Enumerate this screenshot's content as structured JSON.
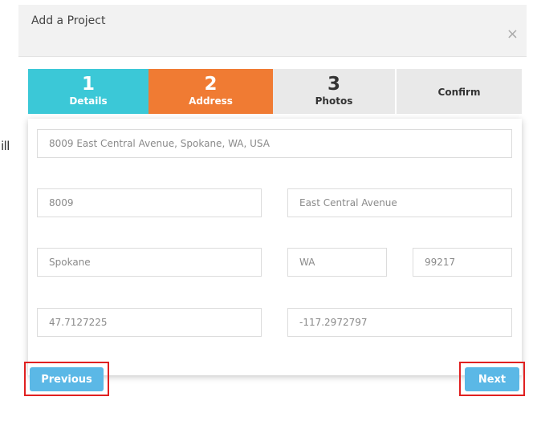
{
  "background": {
    "partial_text": "ill"
  },
  "modal": {
    "title": "Add a Project",
    "close_glyph": "×"
  },
  "steps": [
    {
      "number": "1",
      "label": "Details",
      "state": "complete",
      "color": "#3bc8d7"
    },
    {
      "number": "2",
      "label": "Address",
      "state": "active",
      "color": "#f07b33"
    },
    {
      "number": "3",
      "label": "Photos",
      "state": "pending",
      "color": "#e9e9e9"
    },
    {
      "number": "",
      "label": "Confirm",
      "state": "pending",
      "color": "#e9e9e9"
    }
  ],
  "form": {
    "full_address": "8009 East Central Avenue, Spokane, WA, USA",
    "street_number": "8009",
    "street_name": "East Central Avenue",
    "city": "Spokane",
    "state": "WA",
    "zip": "99217",
    "latitude": "47.7127225",
    "longitude": "-117.2972797"
  },
  "buttons": {
    "previous": "Previous",
    "next": "Next",
    "color": "#5bb8e6"
  },
  "highlight_color": "#e02020"
}
